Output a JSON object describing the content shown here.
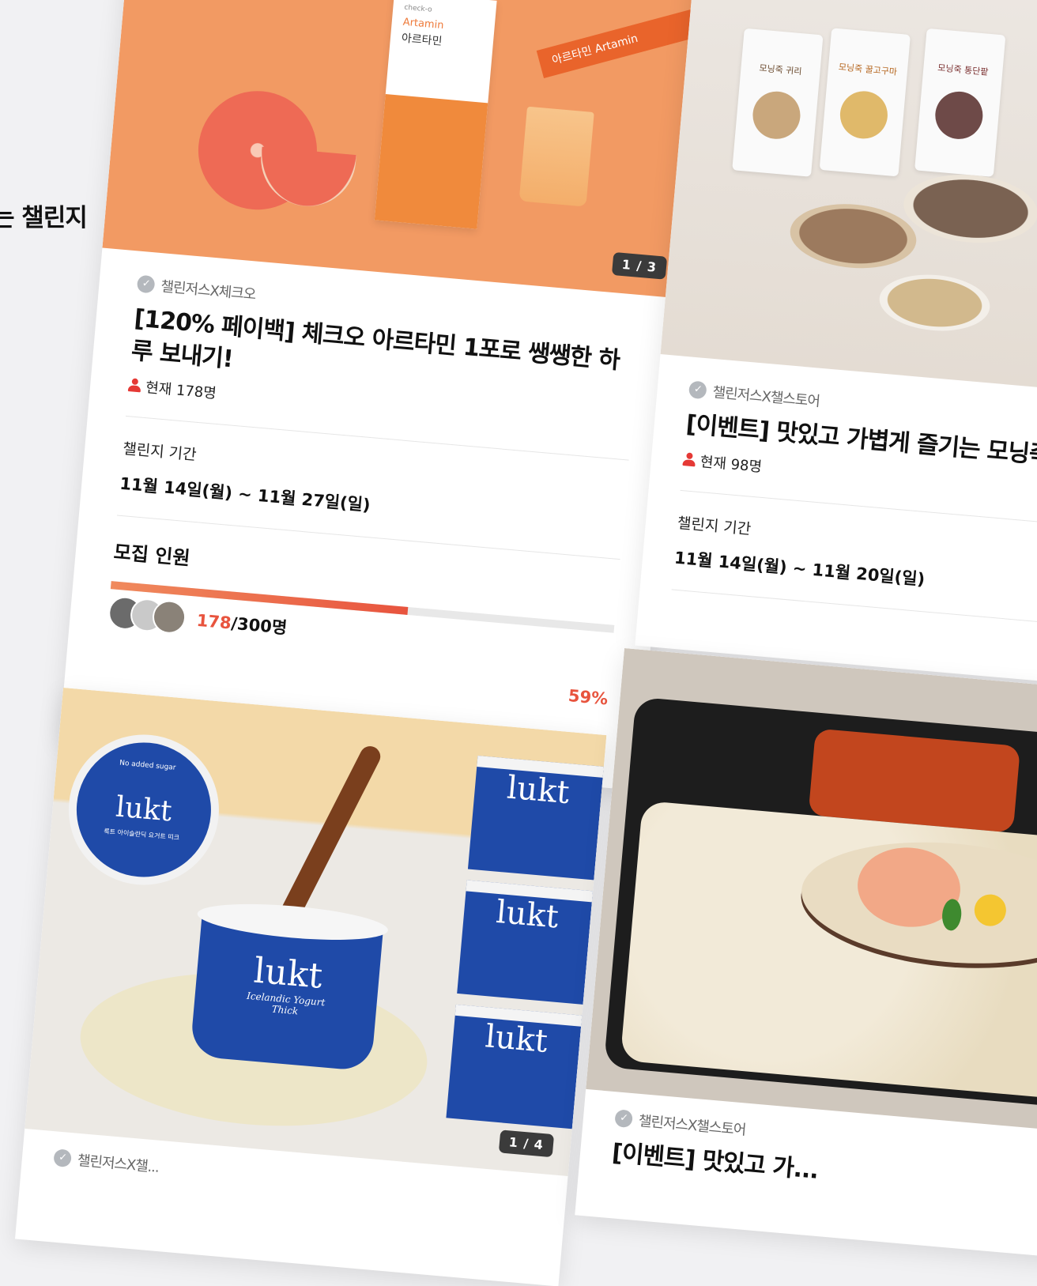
{
  "section": {
    "heading": "는 챌린지"
  },
  "cards": [
    {
      "brand": "챌린저스X체크오",
      "title": "[120% 페이백] 체크오 아르타민 1포로 쌩쌩한 하루 보내기!",
      "current": "현재 178명",
      "page": "1 / 3",
      "period_label": "챌린지 기간",
      "period": "11월 14일(월) ~ 11월 27일(일)",
      "recruit_label": "모집 인원",
      "recruit_joined": "178",
      "recruit_total": "/300명",
      "progress_fraction": 0.59,
      "percent": "59%",
      "product_box_brand": "check-o",
      "product_box_en": "Artamin",
      "product_box_ko": "아르타민",
      "product_stick": "아르타민 Artamin"
    },
    {
      "brand": "챌린저스X챌스토어",
      "title": "[이벤트] 맛있고 가볍게 즐기는 모닝죽",
      "current": "현재 98명",
      "period_label": "챌린지 기간",
      "period": "11월 14일(월) ~ 11월 20일(일)",
      "pouches": [
        "모닝죽 귀리",
        "모닝죽 꿀고구마",
        "모닝죽 통단팥"
      ]
    },
    {
      "brand": "챌린저스X챌...",
      "page": "1 / 4",
      "product_brand": "lukt",
      "product_sub": "Icelandic Yogurt",
      "product_thick": "Thick",
      "lid_label": "No added sugar",
      "lid_ko": "룩트 아이슬란딕 요거트 띠크"
    },
    {
      "brand": "챌린저스X챌스토어",
      "title": "[이벤트] 맛있고 가..."
    }
  ]
}
